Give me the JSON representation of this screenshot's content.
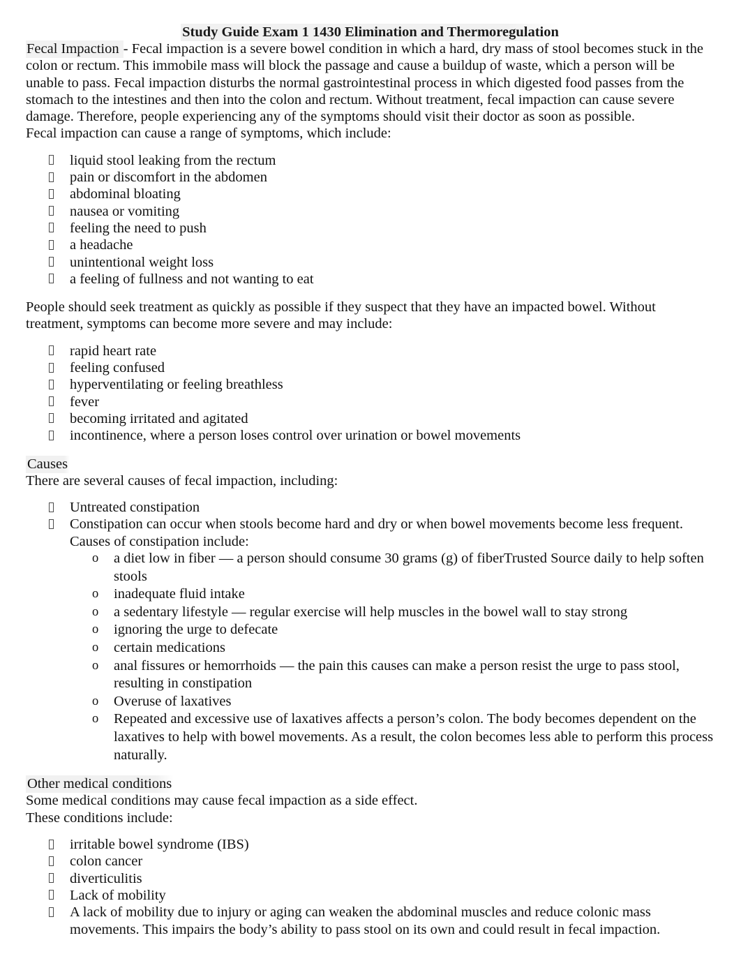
{
  "document": {
    "title": "Study Guide Exam 1 1430 Elimination and Thermoregulation",
    "sections": {
      "fecal_impaction": {
        "term": "Fecal Impaction ",
        "definition": "- Fecal impaction is a severe bowel condition in which a hard, dry mass of stool becomes stuck in the colon or rectum. This immobile mass will block the passage and cause a buildup of waste, which a person will be unable to pass. Fecal impaction disturbs the normal gastrointestinal process in which digested food passes from the stomach to the intestines and then into the colon and rectum. Without treatment, fecal impaction can cause severe damage. Therefore, people experiencing any of the symptoms should visit their doctor as soon as possible.",
        "symptoms_lead": "Fecal impaction can cause a range of symptoms, which include:",
        "symptoms": [
          "liquid stool leaking from the rectum",
          "pain or discomfort in the abdomen",
          "abdominal bloating",
          "nausea or vomiting",
          "feeling the need to push",
          "a headache",
          "unintentional weight loss",
          "a feeling of fullness and not wanting to eat"
        ],
        "severe_lead": "People should seek treatment as quickly as possible if they suspect that they have an impacted bowel. Without treatment, symptoms can become more severe and may include:",
        "severe_symptoms": [
          "rapid heart rate",
          "feeling confused",
          "hyperventilating or feeling breathless",
          "fever",
          "becoming irritated and agitated",
          "incontinence, where a person loses control over urination or bowel movements"
        ]
      },
      "causes": {
        "heading": "Causes",
        "lead": "There are several causes of fecal impaction, including:",
        "items": [
          "Untreated constipation",
          "Constipation can occur when stools become hard and dry or when bowel movements become less frequent. Causes of constipation include:"
        ],
        "constipation_causes": [
          "a diet low in fiber — a person should consume 30 grams (g) of fiberTrusted Source daily to help soften stools",
          "inadequate fluid intake",
          "a sedentary lifestyle — regular exercise will help muscles in the bowel wall to stay strong",
          "ignoring the urge to defecate",
          "certain medications",
          "anal fissures or hemorrhoids — the pain this causes can make a person resist the urge to pass stool, resulting in constipation",
          "Overuse of laxatives",
          "Repeated and excessive use of laxatives affects a person’s colon. The body becomes dependent on the laxatives to help with bowel movements. As a result, the colon becomes less able to perform this process naturally."
        ]
      },
      "other_conditions": {
        "heading": "Other medical conditions",
        "lead_line_1": "Some medical conditions may cause fecal impaction as a side effect.",
        "lead_line_2": "These conditions include:",
        "items": [
          "irritable bowel syndrome (IBS)",
          "colon cancer",
          "diverticulitis",
          "Lack of mobility",
          "A lack of mobility due to injury or aging can weaken the abdominal muscles and reduce colonic mass movements. This impairs the body’s ability to pass stool on its own and could result in fecal impaction."
        ]
      }
    }
  }
}
